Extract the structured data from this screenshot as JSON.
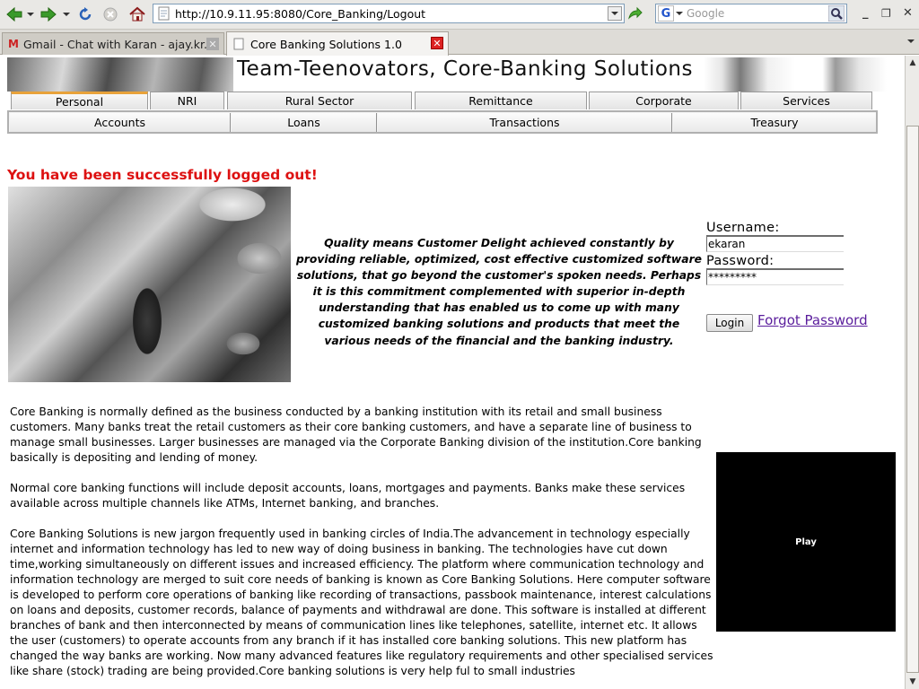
{
  "browser": {
    "url": "http://10.9.11.95:8080/Core_Banking/Logout",
    "search_placeholder": "Google",
    "tabs": [
      {
        "label": "Gmail - Chat with Karan - ajay.kr..."
      },
      {
        "label": "Core Banking Solutions 1.0"
      }
    ]
  },
  "banner": {
    "title": "Team-Teenovators, Core-Banking Solutions"
  },
  "primary_tabs": [
    "Personal",
    "NRI",
    "Rural Sector",
    "Remittance",
    "Corporate",
    "Services"
  ],
  "secondary_tabs": [
    "Accounts",
    "Loans",
    "Transactions",
    "Treasury"
  ],
  "logout_message": "You have been successfully logged out!",
  "quote": "Quality means Customer Delight achieved constantly by providing reliable, optimized, cost effective customized software solutions, that go beyond the customer's spoken needs. Perhaps it is this commitment complemented with superior in-depth understanding that has enabled us to come up with many customized banking solutions and products that meet the various needs of the financial and the banking industry.",
  "login": {
    "username_label": "Username:",
    "username_value": "ekaran",
    "password_label": "Password:",
    "password_value": "*********",
    "login_button": "Login",
    "forgot_password": "Forgot Password"
  },
  "body_paragraphs": [
    "Core Banking is normally defined as the business conducted by a banking institution with its retail and small business customers. Many banks treat the retail customers as their core banking customers, and have a separate line of business to manage small businesses. Larger businesses are managed via the Corporate Banking division of the institution.Core banking basically is depositing and lending of money.",
    "Normal core banking functions will include deposit accounts, loans, mortgages and payments. Banks make these services available across multiple channels like ATMs, Internet banking, and branches.",
    "Core Banking Solutions is new jargon frequently used in banking circles of India.The advancement in technology especially internet and information technology has led to new way of doing business in banking. The technologies have cut down time,working simultaneously on different issues and increased efficiency. The platform where communication technology and information technology are merged to suit core needs of banking is known as Core Banking Solutions. Here computer software is developed to perform core operations of banking like recording of transactions, passbook maintenance, interest calculations on loans and deposits, customer records, balance of payments and withdrawal are done. This software is installed at different branches of bank and then interconnected by means of communication lines like telephones, satellite, internet etc. It allows the user (customers) to operate accounts from any branch if it has installed core banking solutions. This new platform has changed the way banks are working. Now many advanced features like regulatory requirements and other specialised services like share (stock) trading are being provided.Core banking solutions is very help ful to small industries"
  ],
  "video": {
    "play_label": "Play"
  },
  "colors": {
    "logout_red": "#dd1111",
    "link_purple": "#5a1d9c",
    "selected_tab_accent": "#e8a23a"
  }
}
